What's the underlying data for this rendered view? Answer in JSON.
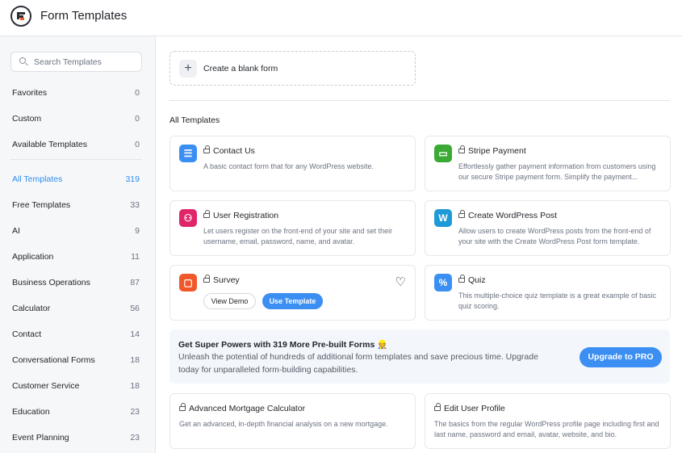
{
  "header": {
    "title": "Form Templates"
  },
  "search": {
    "placeholder": "Search Templates"
  },
  "sidebar": {
    "items": [
      {
        "label": "Favorites",
        "count": "0"
      },
      {
        "label": "Custom",
        "count": "0"
      },
      {
        "label": "Available Templates",
        "count": "0"
      },
      {
        "label": "All Templates",
        "count": "319",
        "active": true
      },
      {
        "label": "Free Templates",
        "count": "33"
      },
      {
        "label": "AI",
        "count": "9"
      },
      {
        "label": "Application",
        "count": "11"
      },
      {
        "label": "Business Operations",
        "count": "87"
      },
      {
        "label": "Calculator",
        "count": "56"
      },
      {
        "label": "Contact",
        "count": "14"
      },
      {
        "label": "Conversational Forms",
        "count": "18"
      },
      {
        "label": "Customer Service",
        "count": "18"
      },
      {
        "label": "Education",
        "count": "23"
      },
      {
        "label": "Event Planning",
        "count": "23"
      }
    ]
  },
  "blank": {
    "label": "Create a blank form"
  },
  "section_title": "All Templates",
  "cards": [
    {
      "name": "Contact Us",
      "desc": "A basic contact form that for any WordPress website.",
      "icon": "list-icon",
      "color": "#3b8ff3"
    },
    {
      "name": "Stripe Payment",
      "desc": "Effortlessly gather payment information from customers using our secure Stripe payment form. Simplify the payment...",
      "icon": "credit-card-icon",
      "color": "#3aaa35"
    },
    {
      "name": "User Registration",
      "desc": "Let users register on the front-end of your site and set their username, email, password, name, and avatar.",
      "icon": "user-plus-icon",
      "color": "#e0266a"
    },
    {
      "name": "Create WordPress Post",
      "desc": "Allow users to create WordPress posts from the front-end of your site with the Create WordPress Post form template.",
      "icon": "wordpress-icon",
      "color": "#1e9ad6"
    },
    {
      "name": "Survey",
      "icon": "chat-icon",
      "color": "#f0582a",
      "view_demo": "View Demo",
      "use_template": "Use Template"
    },
    {
      "name": "Quiz",
      "desc": "This multiple-choice quiz template is a great example of basic quiz scoring.",
      "icon": "percent-icon",
      "color": "#3b8ff3"
    },
    {
      "name": "Advanced Mortgage Calculator",
      "desc": "Get an advanced, in-depth financial analysis on a new mortgage."
    },
    {
      "name": "Edit User Profile",
      "desc": "The basics from the regular WordPress profile page including first and last name, password and email, avatar, website, and bio."
    }
  ],
  "banner": {
    "title": "Get Super Powers with 319 More Pre-built Forms 👷",
    "desc": "Unleash the potential of hundreds of additional form templates and save precious time. Upgrade today for unparalleled form-building capabilities.",
    "button": "Upgrade to PRO"
  }
}
